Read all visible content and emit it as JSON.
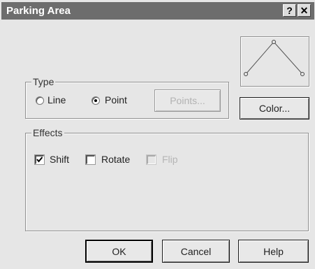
{
  "window": {
    "title": "Parking Area",
    "help_glyph": "?",
    "close_glyph": "✕"
  },
  "type_group": {
    "label": "Type",
    "option_line": "Line",
    "option_point": "Point",
    "selected": "Point",
    "points_button": "Points..."
  },
  "color_button": "Color...",
  "effects_group": {
    "label": "Effects",
    "shift": "Shift",
    "rotate": "Rotate",
    "flip": "Flip",
    "shift_checked": true,
    "rotate_checked": false,
    "flip_checked": false,
    "flip_enabled": false
  },
  "buttons": {
    "ok": "OK",
    "cancel": "Cancel",
    "help": "Help"
  },
  "preview": {
    "icon": "polyline-preview-icon"
  }
}
